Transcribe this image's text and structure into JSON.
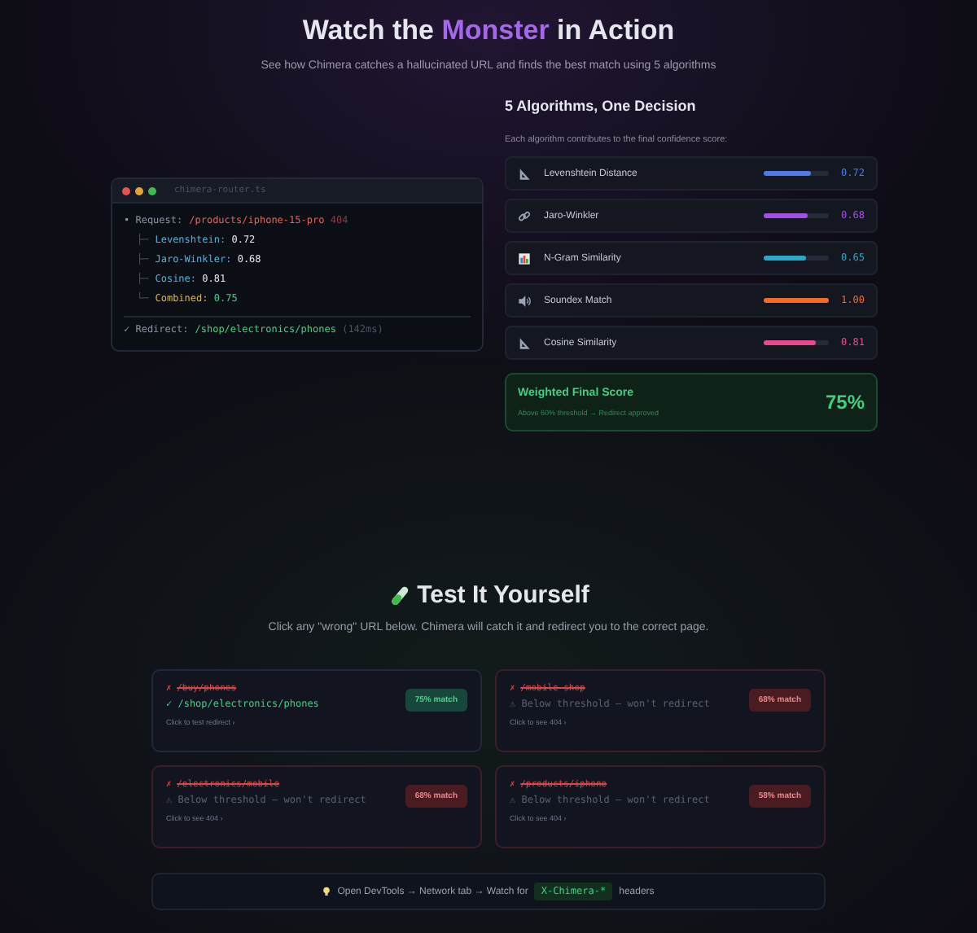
{
  "hero": {
    "title_before": "Watch the",
    "title_highlight": "Monster",
    "title_after": "in Action",
    "subtitle": "See how Chimera catches a hallucinated URL and finds the best match using 5 algorithms"
  },
  "terminal": {
    "filename": "chimera-router.ts",
    "lines": [
      {
        "kind": "request",
        "prefix": "•",
        "label": "Request:",
        "path": "/products/iphone-15-pro",
        "status": "404"
      },
      {
        "kind": "metric",
        "branch": "├─",
        "label": "Levenshtein:",
        "value": "0.72"
      },
      {
        "kind": "metric",
        "branch": "├─",
        "label": "Jaro-Winkler:",
        "value": "0.68"
      },
      {
        "kind": "metric",
        "branch": "├─",
        "label": "Cosine:",
        "value": "0.81"
      },
      {
        "kind": "total",
        "branch": "└─",
        "label": "Combined:",
        "value": "0.75"
      },
      {
        "kind": "redirect",
        "prefix": "✓",
        "label": "Redirect:",
        "path": "/shop/electronics/phones",
        "status": "(142ms)"
      }
    ]
  },
  "algorithms": {
    "title": "5 Algorithms, One Decision",
    "subtitle": "Each algorithm contributes to the final confidence score:",
    "items": [
      {
        "kind": "ruler",
        "name": "Levenshtein Distance",
        "level": 0.72,
        "reading": "0.72",
        "color": "#4f7be8"
      },
      {
        "kind": "link",
        "name": "Jaro-Winkler",
        "level": 0.68,
        "reading": "0.68",
        "color": "#a24ee8"
      },
      {
        "kind": "chart",
        "name": "N-Gram Similarity",
        "level": 0.65,
        "reading": "0.65",
        "color": "#2aa9c9"
      },
      {
        "kind": "sound",
        "name": "Soundex Match",
        "level": 1.0,
        "reading": "1.00",
        "color": "#f26b2a"
      },
      {
        "kind": "ruler",
        "name": "Cosine Similarity",
        "level": 0.81,
        "reading": "0.81",
        "color": "#e8498f"
      }
    ],
    "final": {
      "title": "Weighted Final Score",
      "score": "75%",
      "note": "Above 60% threshold → Redirect approved"
    }
  },
  "test": {
    "title": "Test It Yourself",
    "subtitle": "Click any \"wrong\" URL below. Chimera will catch it and redirect you to the correct page.",
    "cards": [
      {
        "kind": "success",
        "marker": "✗",
        "wrong": "/buy/phones",
        "result": "✓ /shop/electronics/phones",
        "badge": "75% match",
        "hint": "Click to test redirect ›"
      },
      {
        "kind": "fail",
        "marker": "✗",
        "wrong": "/mobile-shop",
        "result": "⚠ Below threshold — won't redirect",
        "badge": "68% match",
        "hint": "Click to see 404 ›"
      },
      {
        "kind": "fail",
        "marker": "✗",
        "wrong": "/electronics/mobile",
        "result": "⚠ Below threshold — won't redirect",
        "badge": "68% match",
        "hint": "Click to see 404 ›"
      },
      {
        "kind": "fail",
        "marker": "✗",
        "wrong": "/products/iphone",
        "result": "⚠ Below threshold — won't redirect",
        "badge": "58% match",
        "hint": "Click to see 404 ›"
      }
    ]
  },
  "tip": {
    "before": "Open DevTools → Network tab → Watch for",
    "code": "X-Chimera-*",
    "after": "headers"
  }
}
